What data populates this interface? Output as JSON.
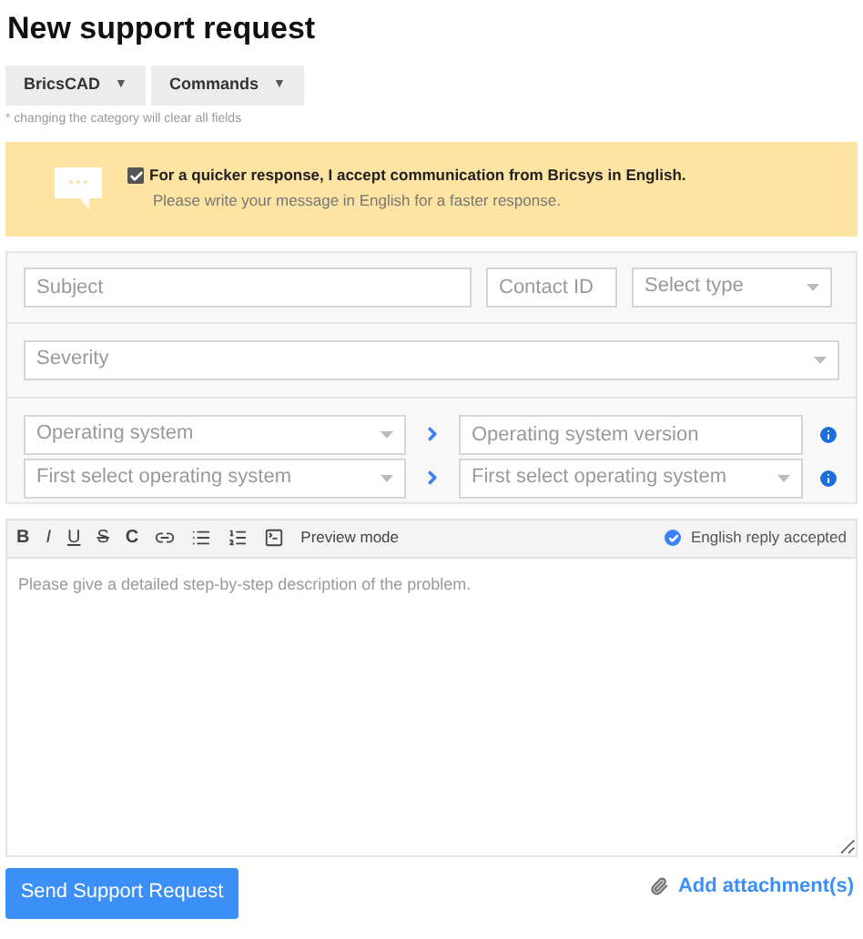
{
  "title": "New support request",
  "categories": [
    {
      "label": "BricsCAD",
      "caret": "▼"
    },
    {
      "label": "Commands",
      "caret": "▼"
    }
  ],
  "category_note": "* changing the category will clear all fields",
  "banner": {
    "checked": true,
    "label": "For a quicker response, I accept communication from Bricsys in English.",
    "hint": "Please write your message in English for a faster response."
  },
  "form": {
    "subject": {
      "placeholder": "Subject"
    },
    "contact_id": {
      "placeholder": "Contact ID"
    },
    "type": {
      "placeholder": "Select type"
    },
    "severity": {
      "placeholder": "Severity"
    },
    "os_rows": [
      {
        "left": {
          "placeholder": "Operating system"
        },
        "right": {
          "kind": "input",
          "placeholder": "Operating system version"
        }
      },
      {
        "left": {
          "placeholder": "First select operating system"
        },
        "right": {
          "kind": "select",
          "placeholder": "First select operating system"
        }
      }
    ]
  },
  "editor": {
    "format_buttons": [
      {
        "label": "B",
        "kind": "bold"
      },
      {
        "label": "I",
        "kind": "italic"
      },
      {
        "label": "U",
        "kind": "underline"
      },
      {
        "label": "S",
        "kind": "strike"
      },
      {
        "label": "C",
        "kind": "code"
      }
    ],
    "preview_label": "Preview mode",
    "english_accepted": true,
    "english_label": "English reply accepted",
    "placeholder": "Please give a detailed step-by-step description of the problem."
  },
  "submit": "Send Support Request",
  "attachment": "Add attachment(s)"
}
